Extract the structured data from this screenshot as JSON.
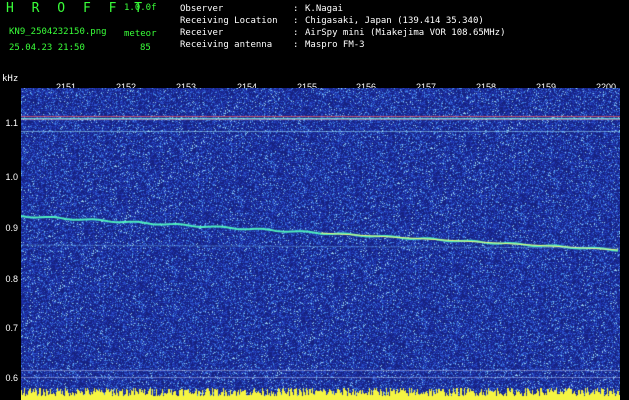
{
  "header": {
    "app_title": "H R O F F T",
    "version": "1.0.0f",
    "filename": "KN9_2504232150.png",
    "timestamp": "25.04.23 21:50",
    "meteor_label": "meteor",
    "meteor_count": "85"
  },
  "info": [
    {
      "key": "Observer",
      "value": "K.Nagai"
    },
    {
      "key": "Receiving Location",
      "value": "Chigasaki, Japan (139.414 35.340)"
    },
    {
      "key": "Receiver",
      "value": "AirSpy mini (Miakejima VOR 108.65MHz)"
    },
    {
      "key": "Receiving antenna",
      "value": "Maspro FM-3"
    }
  ],
  "axis": {
    "y_unit": "kHz",
    "y_ticks": [
      "1.1",
      "1.0",
      "0.9",
      "0.8",
      "0.7",
      "0.6"
    ],
    "x_ticks": [
      "2151",
      "2152",
      "2153",
      "2154",
      "2155",
      "2156",
      "2157",
      "2158",
      "2159",
      "2200"
    ]
  },
  "colors": {
    "background": "#1a2a8e",
    "accent": "#39ff39",
    "trace": "#4ff0c0",
    "bottom_bar": "#f5f542"
  }
}
